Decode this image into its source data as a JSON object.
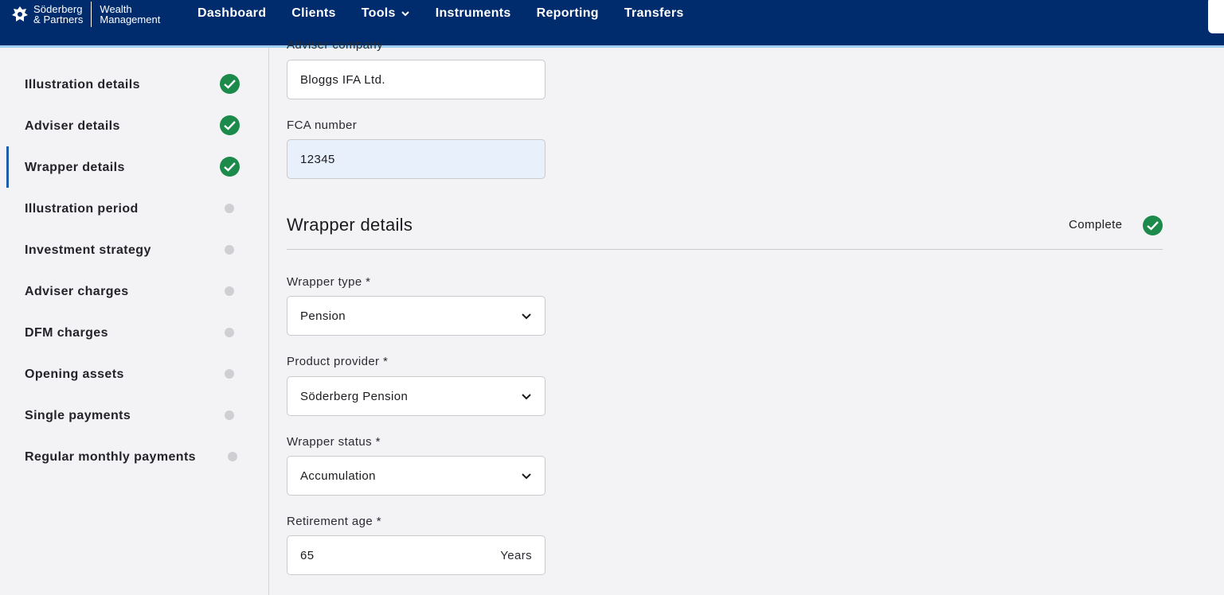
{
  "brand": {
    "name_line1": "Söderberg",
    "name_line2": "& Partners",
    "sub_line1": "Wealth",
    "sub_line2": "Management"
  },
  "nav": {
    "items": [
      {
        "label": "Dashboard"
      },
      {
        "label": "Clients"
      },
      {
        "label": "Tools",
        "has_dropdown": true
      },
      {
        "label": "Instruments"
      },
      {
        "label": "Reporting"
      },
      {
        "label": "Transfers"
      }
    ]
  },
  "sidebar": {
    "items": [
      {
        "label": "Illustration details",
        "status": "complete"
      },
      {
        "label": "Adviser details",
        "status": "complete"
      },
      {
        "label": "Wrapper details",
        "status": "complete",
        "active": true
      },
      {
        "label": "Illustration period",
        "status": "pending"
      },
      {
        "label": "Investment strategy",
        "status": "pending"
      },
      {
        "label": "Adviser charges",
        "status": "pending"
      },
      {
        "label": "DFM charges",
        "status": "pending"
      },
      {
        "label": "Opening assets",
        "status": "pending"
      },
      {
        "label": "Single payments",
        "status": "pending"
      },
      {
        "label": "Regular monthly payments",
        "status": "pending"
      }
    ]
  },
  "adviser": {
    "company_label": "Adviser company",
    "company_value": "Bloggs IFA Ltd.",
    "fca_label": "FCA number",
    "fca_value": "12345"
  },
  "wrapper": {
    "title": "Wrapper details",
    "status": "Complete",
    "type_label": "Wrapper type *",
    "type_value": "Pension",
    "provider_label": "Product provider *",
    "provider_value": "Söderberg Pension",
    "status_label": "Wrapper status *",
    "status_value": "Accumulation",
    "retirement_label": "Retirement age *",
    "retirement_value": "65",
    "retirement_suffix": "Years"
  },
  "colors": {
    "nav_bg": "#002c6e",
    "accent_line": "#9fd0ef",
    "complete_green": "#1c8a4a",
    "pending_grey": "#cfcfd3",
    "active_indicator": "#1c5fa8"
  },
  "icons": {
    "brand": "lion-crest-icon",
    "tools_dropdown": "chevron-down-icon",
    "complete": "check-circle-icon",
    "pending": "dot-icon",
    "select": "chevron-down-icon"
  }
}
